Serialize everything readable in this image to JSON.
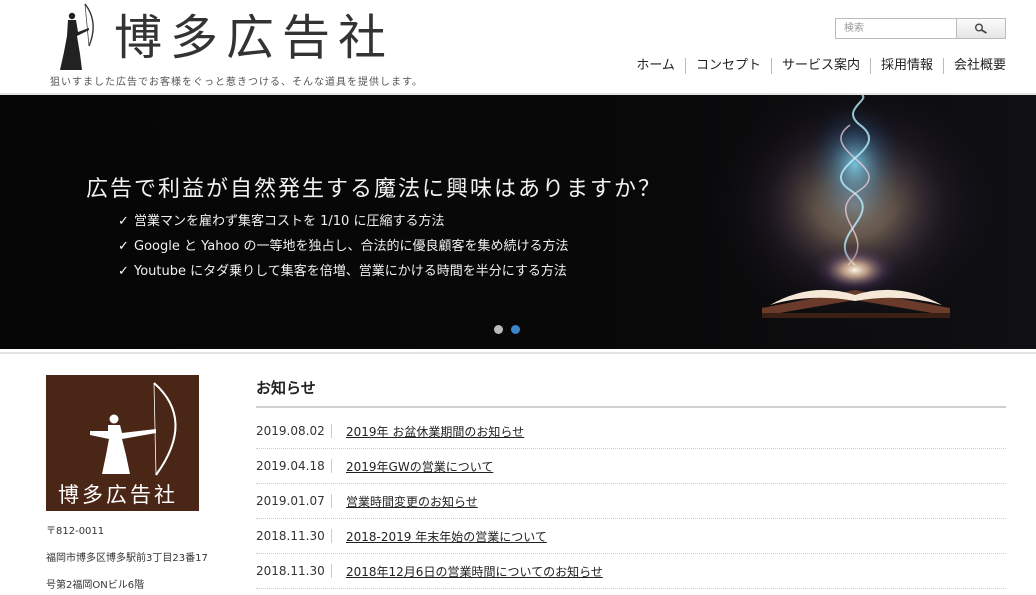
{
  "header": {
    "logo_text": "博多広告社",
    "tagline": "狙いすました広告でお客様をぐっと惹きつける、そんな道具を提供します。",
    "search": {
      "placeholder": "検索"
    },
    "nav": [
      "ホーム",
      "コンセプト",
      "サービス案内",
      "採用情報",
      "会社概要"
    ]
  },
  "hero": {
    "title": "広告で利益が自然発生する魔法に興味はありますか？",
    "check_mark": "✓",
    "points": [
      "営業マンを雇わず集客コストを 1/10 に圧縮する方法",
      "Google と Yahoo の一等地を独占し、合法的に優良顧客を集め続ける方法",
      "Youtube にタダ乗りして集客を倍増、営業にかける時間を半分にする方法"
    ],
    "slides_total": 2,
    "slide_active": 2
  },
  "sidebar": {
    "logo_text": "博多広告社",
    "address_lines": [
      "〒812-0011",
      "福岡市博多区博多駅前3丁目23番17",
      "号第2福岡ONビル6階"
    ]
  },
  "news": {
    "title": "お知らせ",
    "items": [
      {
        "date": "2019.08.02",
        "text": "2019年 お盆休業期間のお知らせ"
      },
      {
        "date": "2019.04.18",
        "text": "2019年GWの営業について"
      },
      {
        "date": "2019.01.07",
        "text": "営業時間変更のお知らせ"
      },
      {
        "date": "2018.11.30",
        "text": "2018-2019 年末年始の営業について"
      },
      {
        "date": "2018.11.30",
        "text": "2018年12月6日の営業時間についてのお知らせ"
      }
    ]
  },
  "colors": {
    "brand_brown": "#4a2616",
    "dot_inactive": "#bbbbbb",
    "dot_active": "#3a86c8"
  },
  "icons": {
    "archer_logo": "archer-icon",
    "search": "magnifier-icon",
    "check": "check-icon"
  }
}
